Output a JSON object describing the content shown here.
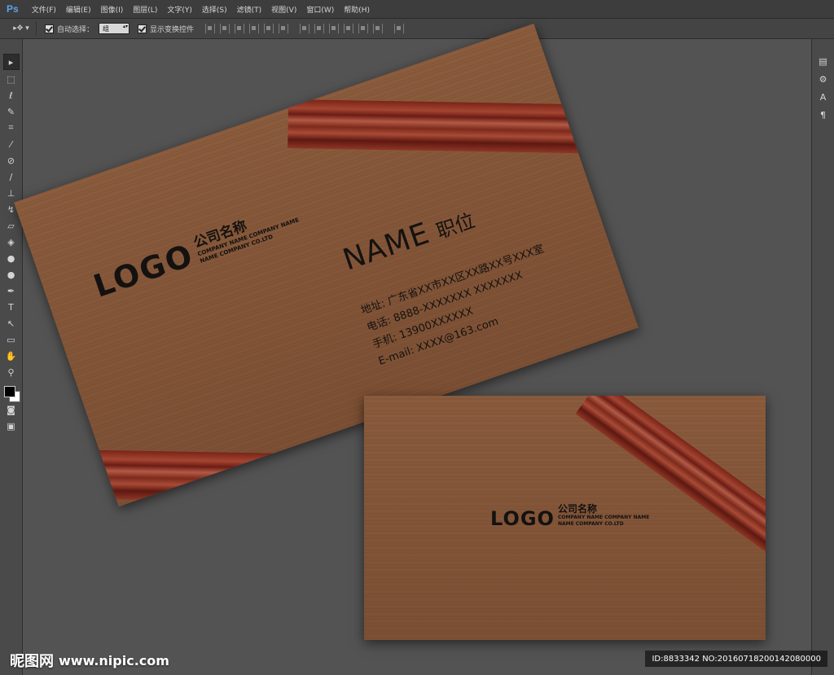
{
  "app": {
    "logo": "Ps"
  },
  "menu": [
    "文件(F)",
    "编辑(E)",
    "图像(I)",
    "图层(L)",
    "文字(Y)",
    "选择(S)",
    "滤镜(T)",
    "视图(V)",
    "窗口(W)",
    "帮助(H)"
  ],
  "options": {
    "auto_select_label": "自动选择：",
    "auto_select_value": "组",
    "show_transform_label": "显示变换控件"
  },
  "front_card": {
    "logo": "LOGO",
    "company_cn": "公司名称",
    "company_en_1": "COMPANY NAME COMPANY NAME",
    "company_en_2": "NAME COMPANY CO.LTD",
    "name": "NAME",
    "title": "职位",
    "address": "地址: 广东省XX市XX区XX路XX号XXX室",
    "phone": "电话: 8888-XXXXXXX    XXXXXXX",
    "mobile": "手机: 13900XXXXXX",
    "email": "E-mail: XXXX@163.com"
  },
  "back_card": {
    "logo": "LOGO",
    "company_cn": "公司名称",
    "company_en_1": "COMPANY NAME COMPANY NAME",
    "company_en_2": "NAME COMPANY CO.LTD"
  },
  "watermark": {
    "brand": "昵图网",
    "url": "www.nipic.com"
  },
  "id_text": "ID:8833342 NO:20160718200142080000"
}
